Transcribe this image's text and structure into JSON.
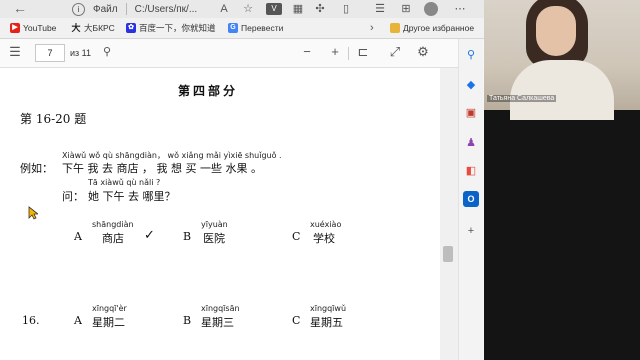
{
  "browser": {
    "nav_back": "←",
    "nav_info": "i",
    "tab_label": "Файл",
    "url": "C:/Users/пк/...",
    "more": "⋯"
  },
  "bookmarks": [
    {
      "label": "YouTube",
      "icon": "youtube-icon",
      "color": "#e62117"
    },
    {
      "label": "大БКРС",
      "icon": "bkrs-icon",
      "color": "#222222"
    },
    {
      "label": "百度一下，你就知道",
      "icon": "baidu-icon",
      "color": "#2932e1"
    },
    {
      "label": "Перевести",
      "icon": "translate-icon",
      "color": "#4285f4"
    },
    {
      "label": "Другое избранное",
      "icon": "folder-icon",
      "color": "#e8b339"
    }
  ],
  "pdf": {
    "current_page": "7",
    "total_pages": "из 11"
  },
  "doc": {
    "part_title": "第四部分",
    "section": "第 16-20 题",
    "example_label": "例如：",
    "example_pinyin": "Xiàwǔ  wǒ  qù  shāngdiàn，  wǒ  xiǎng  mǎi  yìxiē  shuǐguǒ .",
    "example_text": "下午  我  去    商店  ，  我  想  买  一些  水果  。",
    "question_pinyin": "Tā  xiàwǔ  qù  nǎli ?",
    "question_label": "问：",
    "question_text": "她  下午  去  哪里？",
    "example_options": [
      {
        "letter": "A",
        "pinyin": "shāngdiàn",
        "text": "商店",
        "mark": "✓"
      },
      {
        "letter": "B",
        "pinyin": "yīyuàn",
        "text": "医院",
        "mark": ""
      },
      {
        "letter": "C",
        "pinyin": "xuéxiào",
        "text": "学校",
        "mark": ""
      }
    ],
    "q16_number": "16.",
    "q16_options": [
      {
        "letter": "A",
        "pinyin": "xīngqī'èr",
        "text": "星期二"
      },
      {
        "letter": "B",
        "pinyin": "xīngqīsān",
        "text": "星期三"
      },
      {
        "letter": "C",
        "pinyin": "xīngqīwǔ",
        "text": "星期五"
      }
    ]
  },
  "video": {
    "participant_name": "Татьяна Салкашева"
  }
}
